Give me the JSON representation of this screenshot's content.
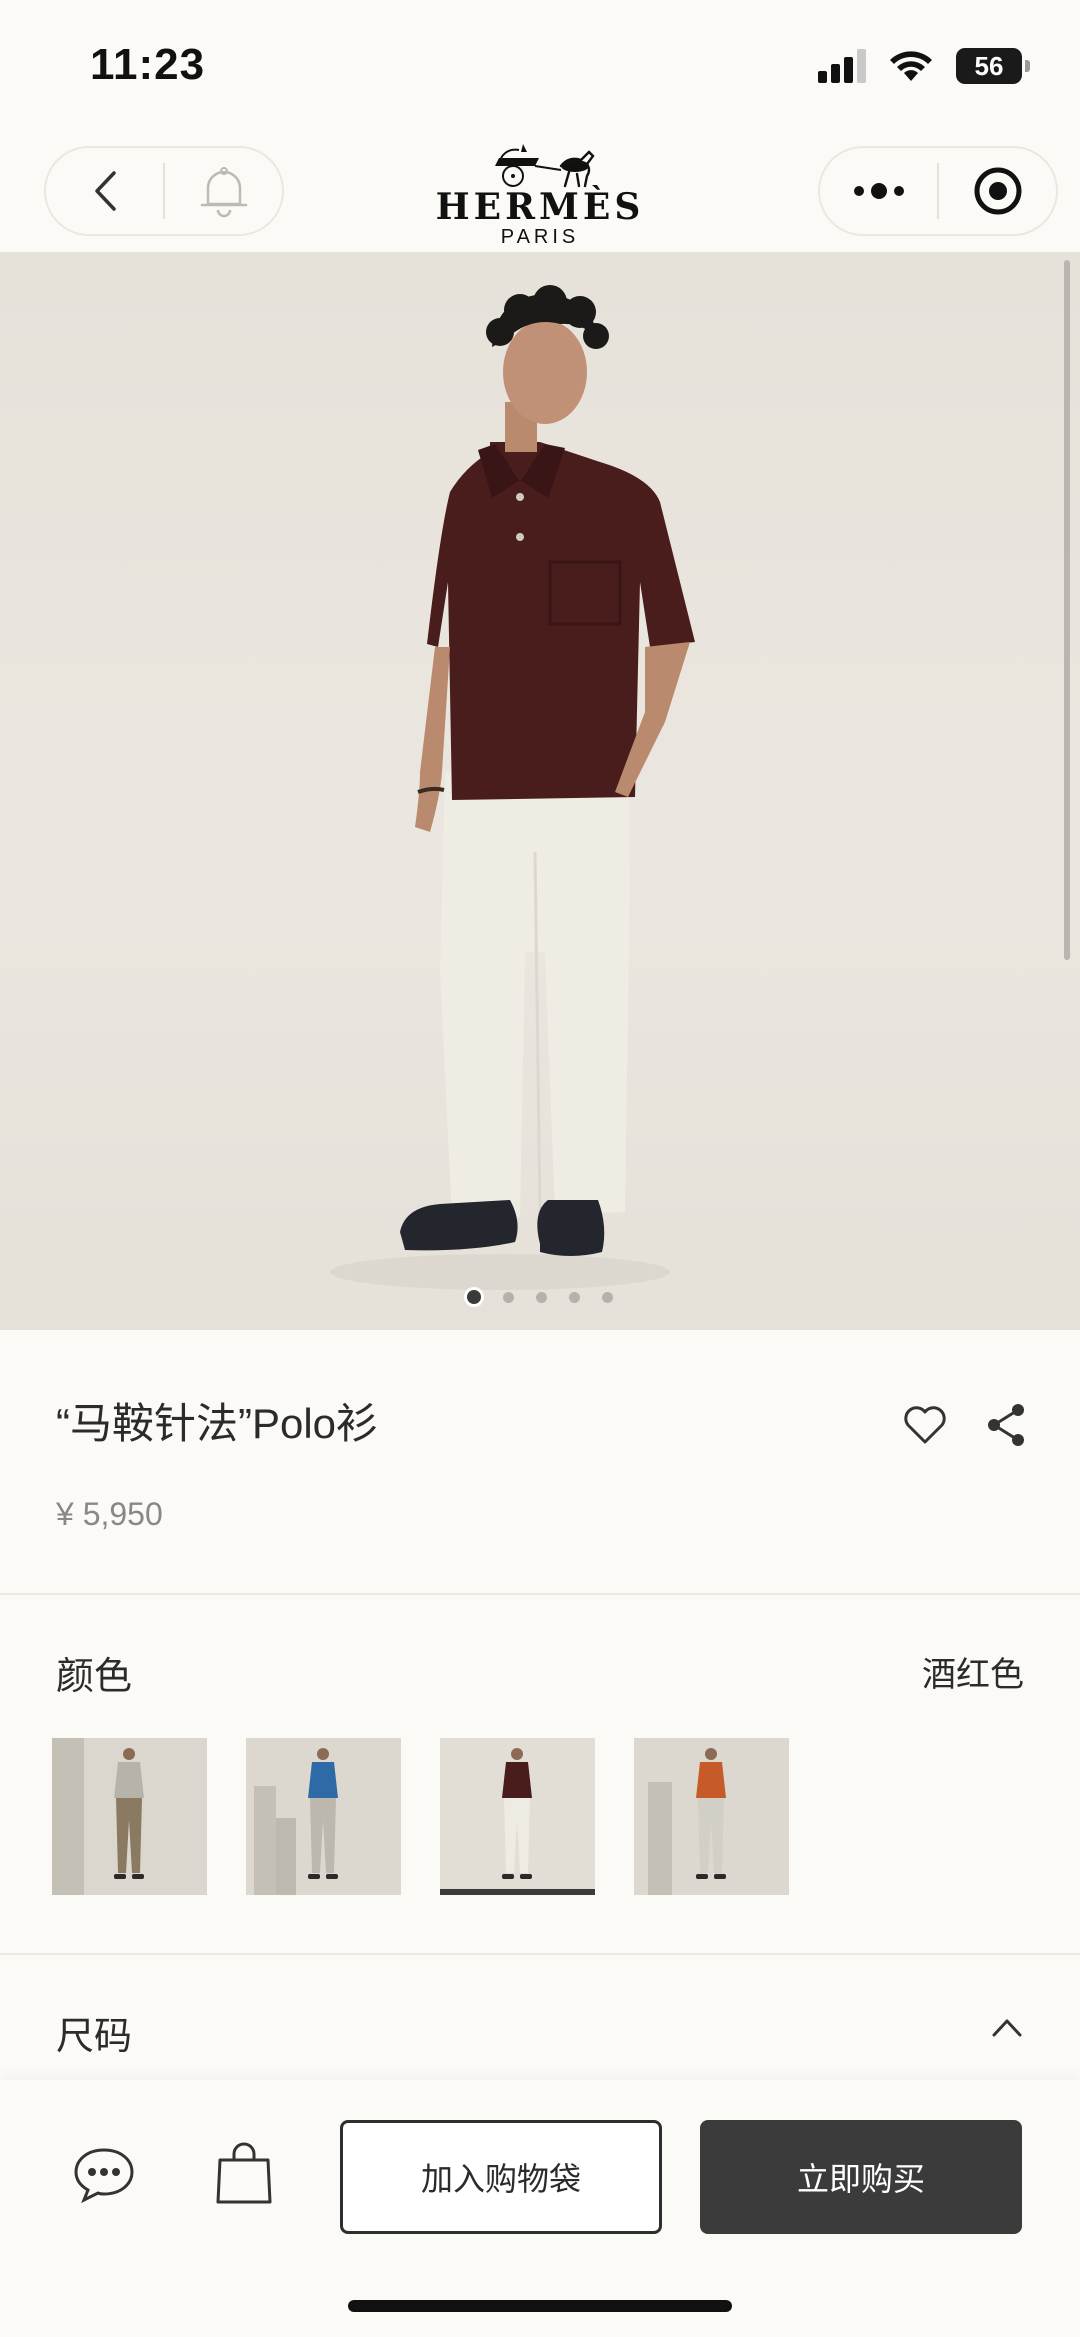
{
  "status_bar": {
    "time": "11:23",
    "battery": "56"
  },
  "header": {
    "brand_name": "HERMÈS",
    "brand_sub": "PARIS"
  },
  "carousel": {
    "count": 5,
    "active_index": 0
  },
  "product": {
    "title": "“马鞍针法”Polo衫",
    "price": "¥ 5,950"
  },
  "color": {
    "label": "颜色",
    "selected_value": "酒红色",
    "swatches": [
      {
        "shirt": "#b6b3ab",
        "pants": "#8b7a62",
        "bg": "#dbd7ce"
      },
      {
        "shirt": "#2e6aa6",
        "pants": "#bcb8ae",
        "bg": "#dcd8cf"
      },
      {
        "shirt": "#4a1d1d",
        "pants": "#eeebe3",
        "bg": "#e2ded6"
      },
      {
        "shirt": "#c65a28",
        "pants": "#d2cfc6",
        "bg": "#dcd8cf"
      }
    ],
    "selected_index": 2
  },
  "size": {
    "label": "尺码"
  },
  "actions": {
    "add_to_bag": "加入购物袋",
    "buy_now": "立即购买"
  },
  "colors": {
    "background": "#fbfaf7",
    "shirt": "#4a1d1d",
    "primary_button": "#3b3b3b"
  }
}
